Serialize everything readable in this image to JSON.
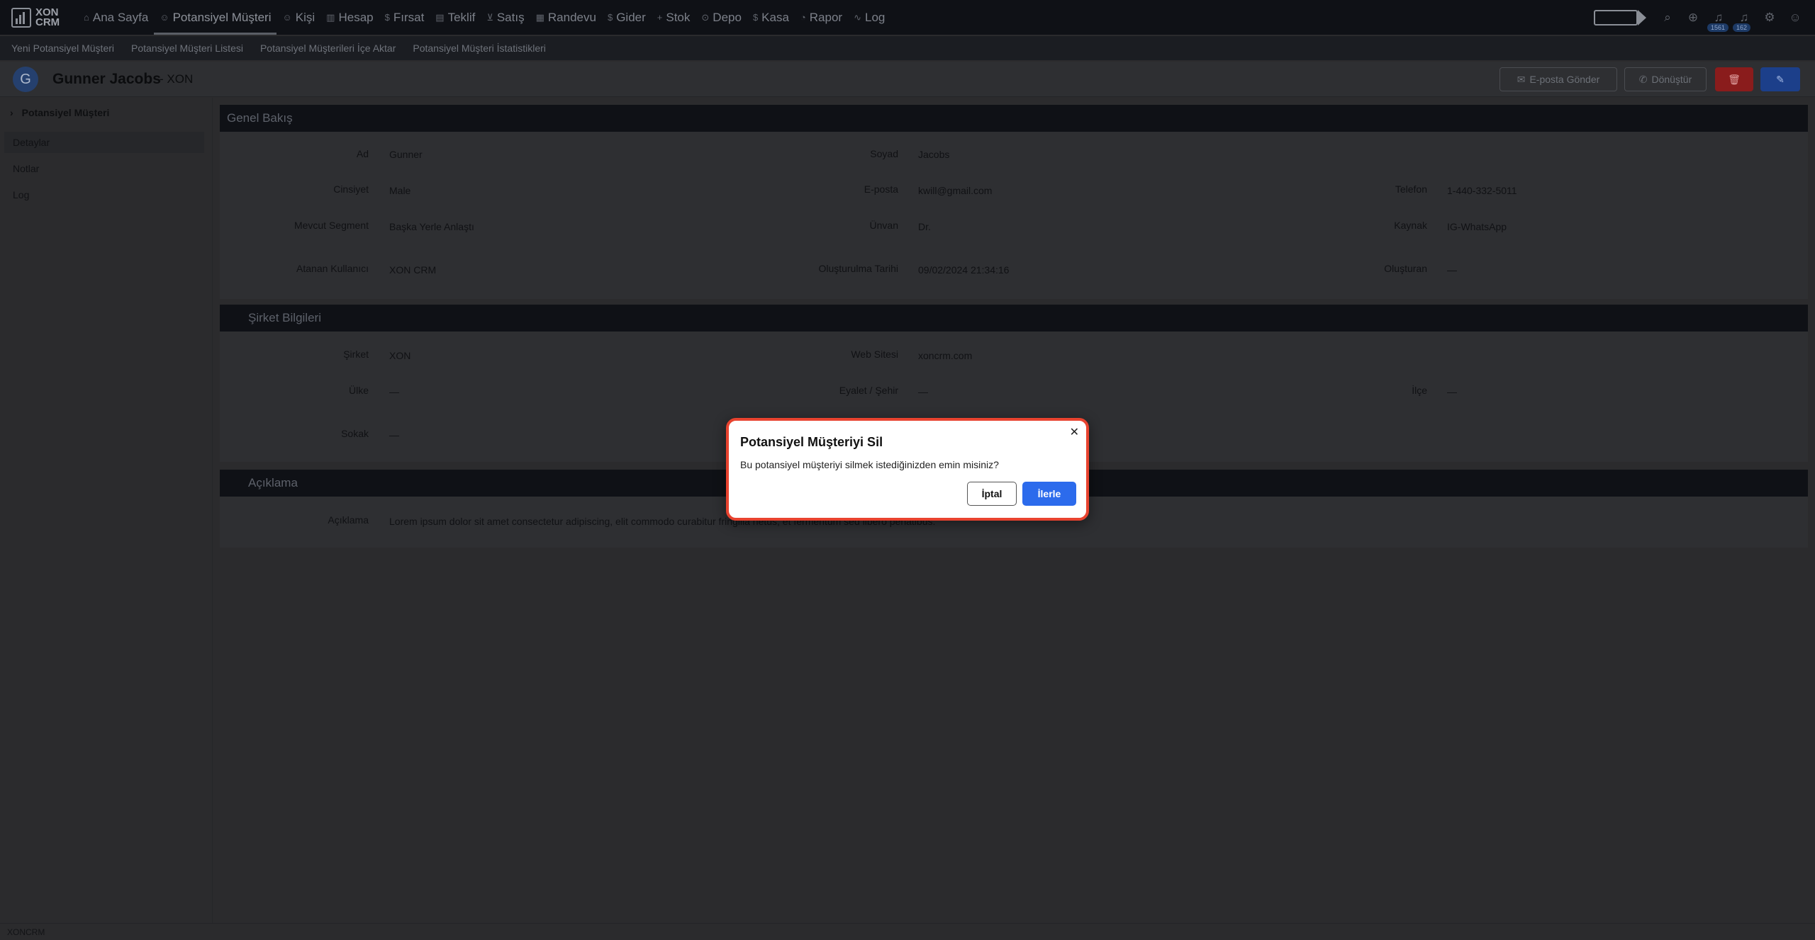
{
  "logo": {
    "line1": "XON",
    "line2": "CRM"
  },
  "nav": {
    "items": [
      {
        "label": "Ana Sayfa",
        "icon": "home-icon"
      },
      {
        "label": "Potansiyel Müşteri",
        "icon": "user-icon",
        "active": true
      },
      {
        "label": "Kişi",
        "icon": "users-icon"
      },
      {
        "label": "Hesap",
        "icon": "building-icon"
      },
      {
        "label": "Fırsat",
        "icon": "dollar-icon"
      },
      {
        "label": "Teklif",
        "icon": "document-icon"
      },
      {
        "label": "Satış",
        "icon": "cart-icon"
      },
      {
        "label": "Randevu",
        "icon": "calendar-icon"
      },
      {
        "label": "Gider",
        "icon": "dollar-icon"
      },
      {
        "label": "Stok",
        "icon": "plus-icon"
      },
      {
        "label": "Depo",
        "icon": "box-icon"
      },
      {
        "label": "Kasa",
        "icon": "dollar-icon"
      },
      {
        "label": "Rapor",
        "icon": "chart-icon"
      },
      {
        "label": "Log",
        "icon": "activity-icon"
      }
    ],
    "badge1": "1561",
    "badge2": "162"
  },
  "subnav": [
    "Yeni Potansiyel Müşteri",
    "Potansiyel Müşteri Listesi",
    "Potansiyel Müşterileri İçe Aktar",
    "Potansiyel Müşteri İstatistikleri"
  ],
  "header": {
    "avatar_letter": "G",
    "name": "Gunner Jacobs",
    "company": "- XON",
    "email_button": "E-posta Gönder",
    "convert_button": "Dönüştür"
  },
  "sidebar": {
    "title": "Potansiyel Müşteri",
    "items": [
      "Detaylar",
      "Notlar",
      "Log"
    ]
  },
  "overview": {
    "title": "Genel Bakış",
    "fields": {
      "ad_label": "Ad",
      "ad": "Gunner",
      "soyad_label": "Soyad",
      "soyad": "Jacobs",
      "cinsiyet_label": "Cinsiyet",
      "cinsiyet": "Male",
      "eposta_label": "E-posta",
      "eposta": "kwill@gmail.com",
      "telefon_label": "Telefon",
      "telefon": "1-440-332-5011",
      "segment_label": "Mevcut Segment",
      "segment": "Başka Yerle Anlaştı",
      "unvan_label": "Ünvan",
      "unvan": "Dr.",
      "kaynak_label": "Kaynak",
      "kaynak": "IG-WhatsApp",
      "atanan_label": "Atanan Kullanıcı",
      "atanan": "XON CRM",
      "tarih_label": "Oluşturulma Tarihi",
      "tarih": "09/02/2024 21:34:16",
      "olusturan_label": "Oluşturan",
      "olusturan": "—"
    }
  },
  "company": {
    "title": "Şirket Bilgileri",
    "fields": {
      "sirket_label": "Şirket",
      "sirket": "XON",
      "web_label": "Web Sitesi",
      "web": "xoncrm.com",
      "ulke_label": "Ülke",
      "ulke": "—",
      "eyalet_label": "Eyalet / Şehir",
      "eyalet": "—",
      "ilce_label": "İlçe",
      "ilce": "—",
      "sokak_label": "Sokak",
      "sokak": "—"
    }
  },
  "description": {
    "title": "Açıklama",
    "label": "Açıklama",
    "value": "Lorem ipsum dolor sit amet consectetur adipiscing, elit commodo curabitur fringilla netus, et fermentum sed libero penatibus."
  },
  "footer": "XONCRM",
  "modal": {
    "title": "Potansiyel Müşteriyi Sil",
    "text": "Bu potansiyel müşteriyi silmek istediğinizden emin misiniz?",
    "cancel": "İptal",
    "confirm": "İlerle"
  }
}
